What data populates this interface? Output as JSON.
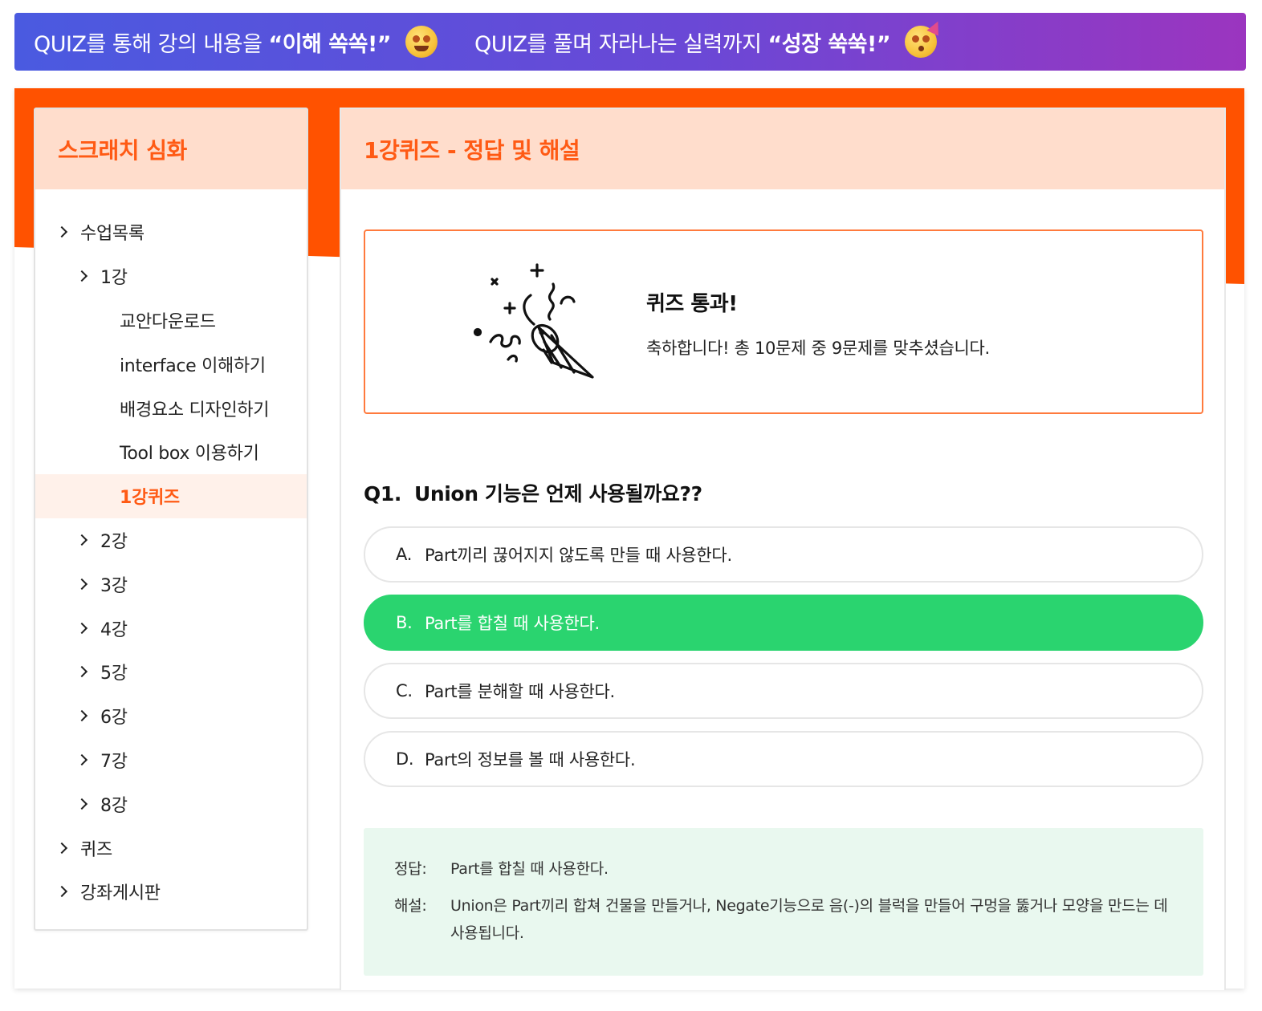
{
  "banner": {
    "part1_prefix": "QUIZ를 통해 강의 내용을",
    "part1_bold": "“이해 쏙쏙!”",
    "part1_emoji": "star-struck-emoji",
    "part2_prefix": "QUIZ를 풀며 자라나는 실력까지",
    "part2_bold": "“성장 쑥쑥!”",
    "part2_emoji": "partying-face-emoji",
    "gradient": [
      "#4a5ae0",
      "#9b35bf"
    ]
  },
  "accent_color": "#ff5200",
  "sidebar": {
    "title": "스크래치 심화",
    "items": [
      {
        "label": "수업목록",
        "level": 0,
        "chevron": true
      },
      {
        "label": "1강",
        "level": 1,
        "chevron": true
      },
      {
        "label": "교안다운로드",
        "level": 2,
        "chevron": false
      },
      {
        "label": "interface 이해하기",
        "level": 2,
        "chevron": false
      },
      {
        "label": "배경요소 디자인하기",
        "level": 2,
        "chevron": false
      },
      {
        "label": "Tool box 이용하기",
        "level": 2,
        "chevron": false
      },
      {
        "label": "1강퀴즈",
        "level": 2,
        "chevron": false,
        "active": true
      },
      {
        "label": "2강",
        "level": 1,
        "chevron": true
      },
      {
        "label": "3강",
        "level": 1,
        "chevron": true
      },
      {
        "label": "4강",
        "level": 1,
        "chevron": true
      },
      {
        "label": "5강",
        "level": 1,
        "chevron": true
      },
      {
        "label": "6강",
        "level": 1,
        "chevron": true
      },
      {
        "label": "7강",
        "level": 1,
        "chevron": true
      },
      {
        "label": "8강",
        "level": 1,
        "chevron": true
      },
      {
        "label": "퀴즈",
        "level": 0,
        "chevron": true
      },
      {
        "label": "강좌게시판",
        "level": 0,
        "chevron": true
      }
    ]
  },
  "content": {
    "title": "1강퀴즈 - 정답 및 해설",
    "result": {
      "icon": "party-popper-icon",
      "title": "퀴즈 통과!",
      "message": "축하합니다! 총 10문제 중 9문제를 맞추셨습니다."
    },
    "question": {
      "number": "Q1.",
      "text": "Union 기능은 언제 사용될까요??",
      "options": [
        {
          "letter": "A.",
          "text": "Part끼리 끊어지지 않도록 만들 때 사용한다.",
          "correct": false
        },
        {
          "letter": "B.",
          "text": "Part를 합칠 때 사용한다.",
          "correct": true
        },
        {
          "letter": "C.",
          "text": "Part를 분해할 때 사용한다.",
          "correct": false
        },
        {
          "letter": "D.",
          "text": "Part의 정보를 볼 때 사용한다.",
          "correct": false
        }
      ],
      "correct_color": "#2ad46f"
    },
    "answer": {
      "answer_label": "정답:",
      "answer_text": "Part를 합칠 때 사용한다.",
      "explain_label": "해설:",
      "explain_text": "Union은 Part끼리 합쳐 건물을 만들거나, Negate기능으로 음(-)의 블럭을 만들어 구멍을 뚫거나 모양을 만드는 데 사용됩니다."
    }
  }
}
